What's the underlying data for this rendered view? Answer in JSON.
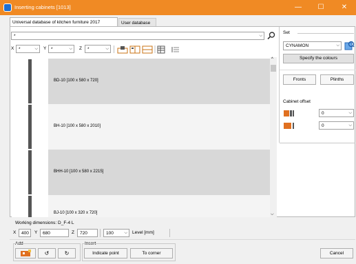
{
  "window": {
    "title": "Inserting cabinets [1013]",
    "minimize": "—",
    "maximize": "☐",
    "close": "✕"
  },
  "tabs": [
    {
      "label": "Universal database of kitchen furniture 2017"
    },
    {
      "label": "User database"
    }
  ],
  "search": {
    "value": "*"
  },
  "filters": {
    "x_label": "X",
    "x_value": "*",
    "y_label": "Y",
    "y_value": "*",
    "z_label": "Z",
    "z_value": "*"
  },
  "cabinets": [
    {
      "label": "BD-10  [100 x 580 x 720]"
    },
    {
      "label": "BH-10  [100 x 580 x 2010]"
    },
    {
      "label": "BHH-10  [100 x 580 x 2215]"
    },
    {
      "label": "BJ-10  [100 x 320 x 720]"
    }
  ],
  "set": {
    "label": "Set",
    "value": "CYNAMON",
    "colours_button": "Specify the colours"
  },
  "buttons": {
    "fronts": "Fronts",
    "plinths": "Plinths",
    "indicate_point": "Indicate point",
    "to_corner": "To corner",
    "cancel": "Cancel"
  },
  "offset": {
    "label": "Cabinet offset",
    "value1": "0",
    "value2": "0"
  },
  "working": {
    "label": "Working dimensions: D_F-4 L",
    "x_label": "X",
    "x": "400",
    "y_label": "Y",
    "y": "680",
    "z_label": "Z",
    "z": "720",
    "level": "100",
    "level_label": "Level [mm]"
  },
  "add": {
    "label": "Add"
  },
  "insert": {
    "label": "Insert"
  },
  "colors": {
    "titlebar": "#f08a24",
    "row_selected": "#d8d8d8",
    "accent": "#e07020"
  }
}
